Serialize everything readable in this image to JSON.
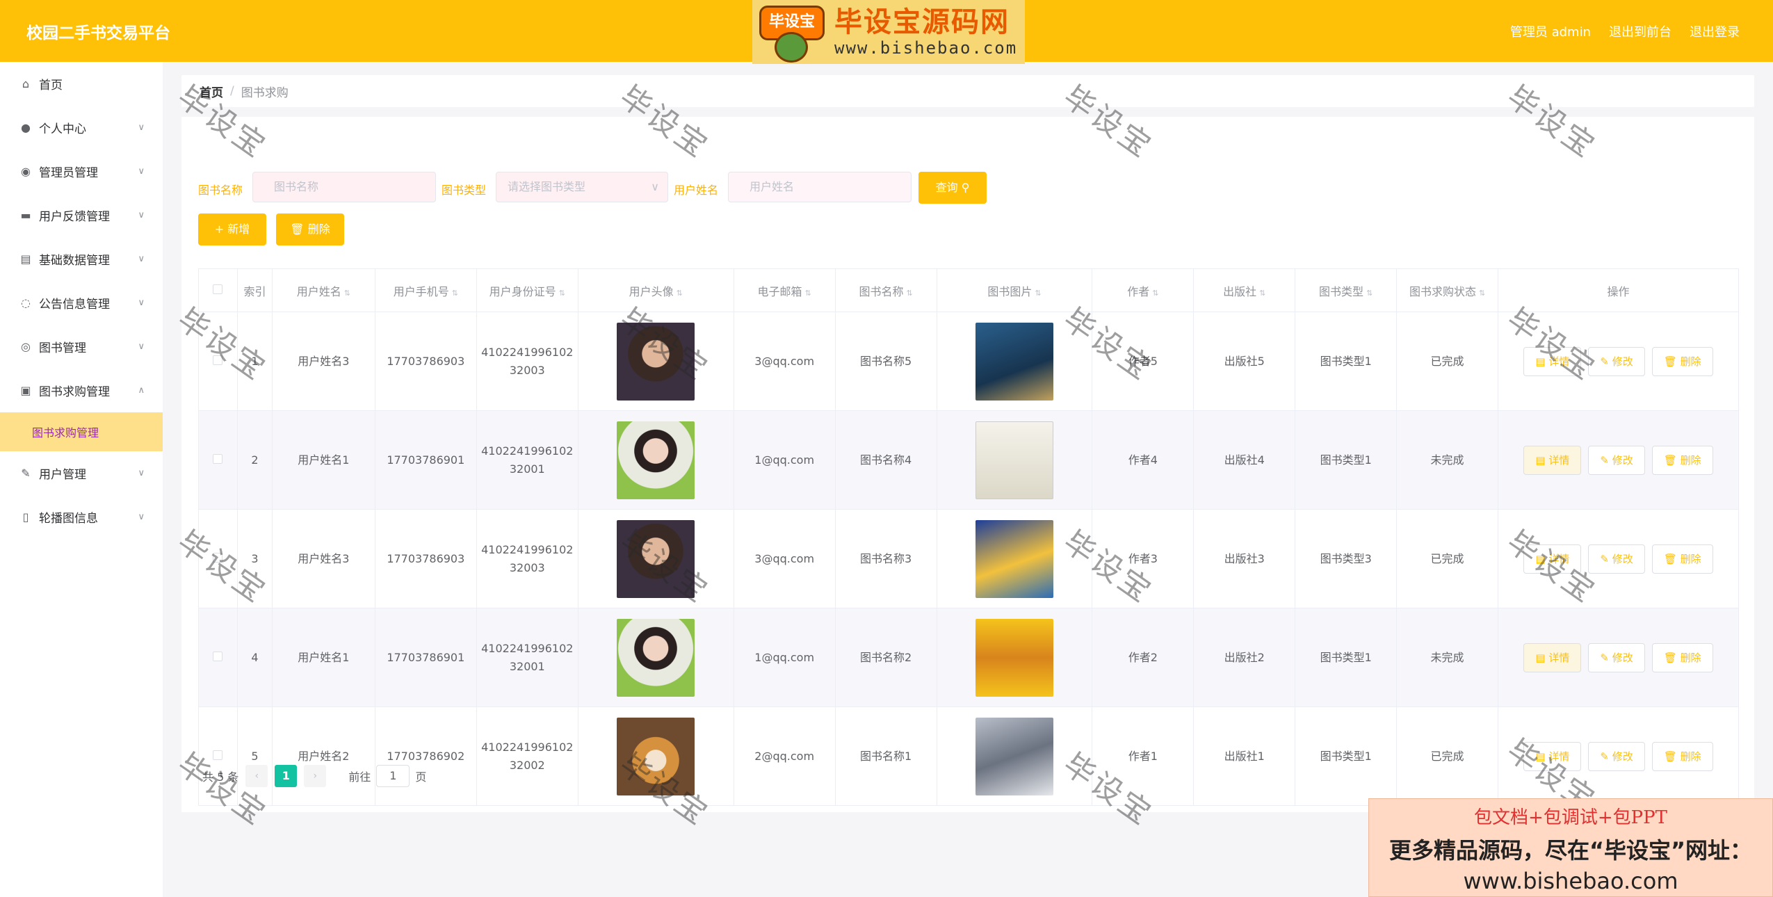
{
  "header": {
    "title": "校园二手书交易平台",
    "links": [
      "管理员 admin",
      "退出到前台",
      "退出登录"
    ]
  },
  "logo": {
    "badge": "毕设宝",
    "title": "毕设宝源码网",
    "url": "www.bishebao.com"
  },
  "sidebar": {
    "items": [
      {
        "label": "首页",
        "icon": "home-icon"
      },
      {
        "label": "个人中心",
        "icon": "user-icon"
      },
      {
        "label": "管理员管理",
        "icon": "location-icon"
      },
      {
        "label": "用户反馈管理",
        "icon": "monitor-icon"
      },
      {
        "label": "基础数据管理",
        "icon": "signpost-icon"
      },
      {
        "label": "公告信息管理",
        "icon": "power-icon"
      },
      {
        "label": "图书管理",
        "icon": "globe-icon"
      },
      {
        "label": "图书求购管理",
        "icon": "chart-icon"
      },
      {
        "label": "用户管理",
        "icon": "edit-icon"
      },
      {
        "label": "轮播图信息",
        "icon": "mic-icon"
      }
    ],
    "active_sub": "图书求购管理"
  },
  "breadcrumb": {
    "home": "首页",
    "sep": "/",
    "current": "图书求购"
  },
  "search": {
    "book_name_label": "图书名称",
    "book_name_placeholder": "图书名称",
    "book_type_label": "图书类型",
    "book_type_placeholder": "请选择图书类型",
    "user_name_label": "用户姓名",
    "user_name_placeholder": "用户姓名",
    "query_label": "查询"
  },
  "actions": {
    "add_label": "新增",
    "delete_label": "删除"
  },
  "table": {
    "headers": [
      "索引",
      "用户姓名",
      "用户手机号",
      "用户身份证号",
      "用户头像",
      "电子邮箱",
      "图书名称",
      "图书图片",
      "作者",
      "出版社",
      "图书类型",
      "图书求购状态",
      "操作"
    ],
    "rows": [
      {
        "index": "1",
        "name": "用户姓名3",
        "phone": "17703786903",
        "id_a": "4102241996102",
        "id_b": "32003",
        "email": "3@qq.com",
        "book": "图书名称5",
        "author": "作者5",
        "publisher": "出版社5",
        "type": "图书类型1",
        "status": "已完成"
      },
      {
        "index": "2",
        "name": "用户姓名1",
        "phone": "17703786901",
        "id_a": "4102241996102",
        "id_b": "32001",
        "email": "1@qq.com",
        "book": "图书名称4",
        "author": "作者4",
        "publisher": "出版社4",
        "type": "图书类型1",
        "status": "未完成"
      },
      {
        "index": "3",
        "name": "用户姓名3",
        "phone": "17703786903",
        "id_a": "4102241996102",
        "id_b": "32003",
        "email": "3@qq.com",
        "book": "图书名称3",
        "author": "作者3",
        "publisher": "出版社3",
        "type": "图书类型3",
        "status": "已完成"
      },
      {
        "index": "4",
        "name": "用户姓名1",
        "phone": "17703786901",
        "id_a": "4102241996102",
        "id_b": "32001",
        "email": "1@qq.com",
        "book": "图书名称2",
        "author": "作者2",
        "publisher": "出版社2",
        "type": "图书类型1",
        "status": "未完成"
      },
      {
        "index": "5",
        "name": "用户姓名2",
        "phone": "17703786902",
        "id_a": "4102241996102",
        "id_b": "32002",
        "email": "2@qq.com",
        "book": "图书名称1",
        "author": "作者1",
        "publisher": "出版社1",
        "type": "图书类型1",
        "status": "已完成"
      }
    ],
    "op_labels": {
      "detail": "详情",
      "edit": "修改",
      "delete": "删除"
    }
  },
  "pagination": {
    "total": "共 5 条",
    "page": "1",
    "goto_prefix": "前往",
    "goto_value": "1",
    "goto_suffix": "页"
  },
  "watermark": "毕设宝",
  "promo": {
    "line1": "包文档+包调试+包PPT",
    "line2": "更多精品源码，尽在“毕设宝”网址：",
    "line3": "www.bishebao.com"
  },
  "colors": {
    "accent": "#ffc107",
    "active_sub_bg": "#ffe08a",
    "pager_active": "#13c2a1"
  }
}
